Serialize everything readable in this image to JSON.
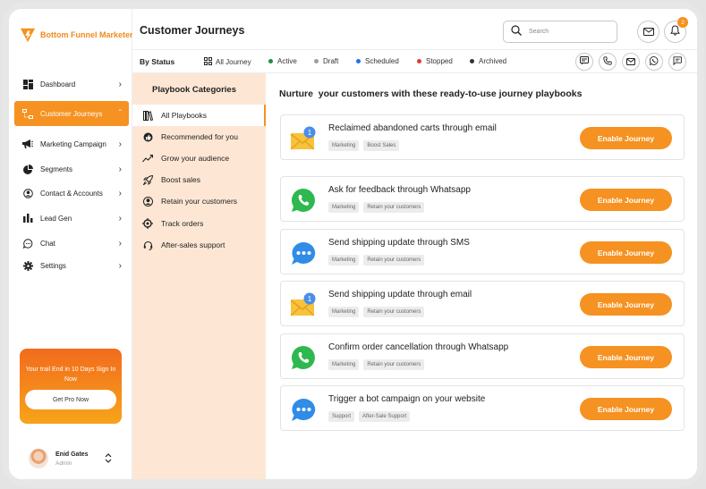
{
  "brand": {
    "name": "Bottom Funnel Marketer",
    "accent": "#f59221"
  },
  "sidebar": {
    "items": [
      {
        "label": "Dashboard",
        "icon": "dashboard-icon"
      },
      {
        "label": "Customer Journeys",
        "icon": "journey-icon",
        "active": true
      },
      {
        "label": "Marketing Campaign",
        "icon": "megaphone-icon"
      },
      {
        "label": "Segments",
        "icon": "pie-chart-icon"
      },
      {
        "label": "Contact & Accounts",
        "icon": "user-circle-icon"
      },
      {
        "label": "Lead Gen",
        "icon": "bar-chart-icon"
      },
      {
        "label": "Chat",
        "icon": "chat-bubble-icon"
      },
      {
        "label": "Settings",
        "icon": "gear-icon"
      }
    ],
    "promo": {
      "text": "Your trail End in 10 Days Sign In Now",
      "button": "Get Pro Now"
    },
    "user": {
      "name": "Enid Gates",
      "role": "Admin"
    }
  },
  "header": {
    "title": "Customer Journeys",
    "search_placeholder": "Search",
    "notification_count": "2"
  },
  "status_bar": {
    "label": "By Status",
    "filters": [
      {
        "label": "All Journey",
        "color": ""
      },
      {
        "label": "Active",
        "color": "#1e8e3e"
      },
      {
        "label": "Draft",
        "color": "#9e9e9e"
      },
      {
        "label": "Scheduled",
        "color": "#1e73e8"
      },
      {
        "label": "Stopped",
        "color": "#e53935"
      },
      {
        "label": "Archived",
        "color": "#333333"
      }
    ],
    "channels": [
      "sms-chat-icon",
      "phone-icon",
      "mail-icon",
      "whatsapp-icon",
      "message-icon"
    ]
  },
  "categories": {
    "title": "Playbook Categories",
    "items": [
      {
        "label": "All Playbooks",
        "icon": "books-icon",
        "active": true
      },
      {
        "label": "Recommended for you",
        "icon": "thumb-icon"
      },
      {
        "label": "Grow your audience",
        "icon": "trend-icon"
      },
      {
        "label": "Boost sales",
        "icon": "rocket-icon"
      },
      {
        "label": "Retain your customers",
        "icon": "person-icon"
      },
      {
        "label": "Track orders",
        "icon": "target-icon"
      },
      {
        "label": "After-sales support",
        "icon": "headset-icon"
      }
    ]
  },
  "main": {
    "heading": "Nurture  your customers with these ready-to-use journey playbooks",
    "button_label": "Enable Journey",
    "playbooks": [
      {
        "title": "Reclaimed abandoned carts through email",
        "icon": "email-envelope-icon",
        "tags": [
          "Marketing",
          "Boost Sales"
        ]
      },
      {
        "title": "Ask for feedback through Whatsapp",
        "icon": "whatsapp-icon",
        "tags": [
          "Marketing",
          "Retain your customers"
        ]
      },
      {
        "title": "Send shipping update through SMS",
        "icon": "sms-bubble-icon",
        "tags": [
          "Marketing",
          "Retain your customers"
        ]
      },
      {
        "title": "Send shipping update through email",
        "icon": "email-envelope-icon",
        "tags": [
          "Marketing",
          "Retain your customers"
        ]
      },
      {
        "title": "Confirm order cancellation through Whatsapp",
        "icon": "whatsapp-icon",
        "tags": [
          "Marketing",
          "Retain your customers"
        ]
      },
      {
        "title": "Trigger a bot campaign on your website",
        "icon": "sms-bubble-icon",
        "tags": [
          "Support",
          "After-Sale Support"
        ]
      }
    ]
  }
}
